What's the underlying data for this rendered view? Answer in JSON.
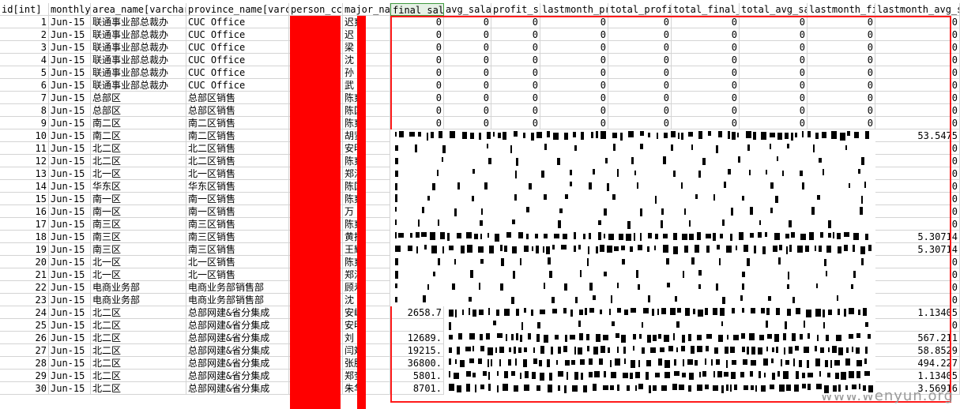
{
  "sheet": {
    "headers": [
      "id[int]",
      "monthly",
      "area_name[varchar",
      "province_name[varc",
      "person_cc",
      "major_na",
      "final_sal",
      "avg_sala",
      "profit_s",
      "lastmonth_pr",
      "total_profi",
      "total_final_",
      "total_avg_sa",
      "lastmonth_fi",
      "lastmonth_avg_s"
    ],
    "selected_header": "final_sal",
    "rows": [
      {
        "id": "1",
        "month": "Jun-15",
        "area": "联通事业部总裁办",
        "province": "CUC Office",
        "major": "迟爽",
        "vals": [
          "0",
          "0",
          "0",
          "0",
          "0",
          "0",
          "0",
          "0",
          "0"
        ]
      },
      {
        "id": "2",
        "month": "Jun-15",
        "area": "联通事业部总裁办",
        "province": "CUC Office",
        "major": "迟",
        "vals": [
          "0",
          "0",
          "0",
          "0",
          "0",
          "0",
          "0",
          "0",
          "0"
        ]
      },
      {
        "id": "3",
        "month": "Jun-15",
        "area": "联通事业部总裁办",
        "province": "CUC Office",
        "major": "梁",
        "vals": [
          "0",
          "0",
          "0",
          "0",
          "0",
          "0",
          "0",
          "0",
          "0"
        ]
      },
      {
        "id": "4",
        "month": "Jun-15",
        "area": "联通事业部总裁办",
        "province": "CUC Office",
        "major": "沈",
        "vals": [
          "0",
          "0",
          "0",
          "0",
          "0",
          "0",
          "0",
          "0",
          "0"
        ]
      },
      {
        "id": "5",
        "month": "Jun-15",
        "area": "联通事业部总裁办",
        "province": "CUC Office",
        "major": "孙",
        "vals": [
          "0",
          "0",
          "0",
          "0",
          "0",
          "0",
          "0",
          "0",
          "0"
        ]
      },
      {
        "id": "6",
        "month": "Jun-15",
        "area": "联通事业部总裁办",
        "province": "CUC Office",
        "major": "武",
        "vals": [
          "0",
          "0",
          "0",
          "0",
          "0",
          "0",
          "0",
          "0",
          "0"
        ]
      },
      {
        "id": "7",
        "month": "Jun-15",
        "area": "总部区",
        "province": "总部区销售",
        "major": "陈爽",
        "vals": [
          "0",
          "0",
          "0",
          "0",
          "0",
          "0",
          "0",
          "0",
          "0"
        ]
      },
      {
        "id": "8",
        "month": "Jun-15",
        "area": "总部区",
        "province": "总部区销售",
        "major": "陈国",
        "vals": [
          "0",
          "0",
          "0",
          "0",
          "0",
          "0",
          "0",
          "0",
          "0"
        ]
      },
      {
        "id": "9",
        "month": "Jun-15",
        "area": "南二区",
        "province": "南二区销售",
        "major": "陈爽",
        "vals": [
          "0",
          "0",
          "0",
          "0",
          "0",
          "0",
          "0",
          "0",
          "0"
        ]
      },
      {
        "id": "10",
        "month": "Jun-15",
        "area": "南二区",
        "province": "南二区销售",
        "major": "胡贤",
        "vals": [
          "",
          "",
          "",
          "",
          "",
          "",
          "",
          "",
          "53.5475"
        ]
      },
      {
        "id": "11",
        "month": "Jun-15",
        "area": "北二区",
        "province": "北二区销售",
        "major": "安明",
        "vals": [
          "",
          "",
          "",
          "",
          "",
          "",
          "",
          "",
          "0"
        ]
      },
      {
        "id": "12",
        "month": "Jun-15",
        "area": "北二区",
        "province": "北二区销售",
        "major": "陈爽",
        "vals": [
          "",
          "",
          "",
          "",
          "",
          "",
          "",
          "",
          "0"
        ]
      },
      {
        "id": "13",
        "month": "Jun-15",
        "area": "北一区",
        "province": "北一区销售",
        "major": "郑江",
        "vals": [
          "",
          "",
          "",
          "",
          "",
          "",
          "",
          "",
          "0"
        ]
      },
      {
        "id": "14",
        "month": "Jun-15",
        "area": "华东区",
        "province": "华东区销售",
        "major": "陈国",
        "vals": [
          "",
          "",
          "",
          "",
          "",
          "",
          "",
          "",
          "0"
        ]
      },
      {
        "id": "15",
        "month": "Jun-15",
        "area": "南一区",
        "province": "南一区销售",
        "major": "陈爽",
        "vals": [
          "",
          "",
          "",
          "",
          "",
          "",
          "",
          "",
          "0"
        ]
      },
      {
        "id": "16",
        "month": "Jun-15",
        "area": "南一区",
        "province": "南一区销售",
        "major": "万",
        "vals": [
          "",
          "",
          "",
          "",
          "",
          "",
          "",
          "",
          "0"
        ]
      },
      {
        "id": "17",
        "month": "Jun-15",
        "area": "南三区",
        "province": "南三区销售",
        "major": "陈爽",
        "vals": [
          "",
          "",
          "",
          "",
          "",
          "",
          "",
          "",
          "0"
        ]
      },
      {
        "id": "18",
        "month": "Jun-15",
        "area": "南三区",
        "province": "南三区销售",
        "major": "黄扬",
        "vals": [
          "",
          "",
          "",
          "",
          "",
          "",
          "",
          "",
          "5.30714"
        ]
      },
      {
        "id": "19",
        "month": "Jun-15",
        "area": "南三区",
        "province": "南三区销售",
        "major": "王辉",
        "vals": [
          "",
          "",
          "",
          "",
          "",
          "",
          "",
          "",
          "5.30714"
        ]
      },
      {
        "id": "20",
        "month": "Jun-15",
        "area": "北一区",
        "province": "北一区销售",
        "major": "陈爽",
        "vals": [
          "",
          "",
          "",
          "",
          "",
          "",
          "",
          "",
          "0"
        ]
      },
      {
        "id": "21",
        "month": "Jun-15",
        "area": "北一区",
        "province": "北一区销售",
        "major": "郑江",
        "vals": [
          "",
          "",
          "",
          "",
          "",
          "",
          "",
          "",
          "0"
        ]
      },
      {
        "id": "22",
        "month": "Jun-15",
        "area": "电商业务部",
        "province": "电商业务部销售部",
        "major": "顾寿",
        "vals": [
          "",
          "",
          "",
          "",
          "",
          "",
          "",
          "",
          "0"
        ]
      },
      {
        "id": "23",
        "month": "Jun-15",
        "area": "电商业务部",
        "province": "电商业务部销售部",
        "major": "沈",
        "vals": [
          "",
          "",
          "",
          "",
          "",
          "",
          "",
          "",
          "0"
        ]
      },
      {
        "id": "24",
        "month": "Jun-15",
        "area": "北二区",
        "province": "总部网建&省分集成",
        "major": "安峰",
        "vals": [
          "2658.7",
          "",
          "",
          "",
          "",
          "",
          "",
          "",
          "1.13405"
        ]
      },
      {
        "id": "25",
        "month": "Jun-15",
        "area": "北二区",
        "province": "总部网建&省分集成",
        "major": "安明",
        "vals": [
          "",
          "",
          "",
          "",
          "",
          "",
          "",
          "",
          "0"
        ]
      },
      {
        "id": "26",
        "month": "Jun-15",
        "area": "北二区",
        "province": "总部网建&省分集成",
        "major": "刘",
        "vals": [
          "12689.",
          "",
          "",
          "",
          "",
          "",
          "",
          "",
          "567.211"
        ]
      },
      {
        "id": "27",
        "month": "Jun-15",
        "area": "北二区",
        "province": "总部网建&省分集成",
        "major": "闫斌",
        "vals": [
          "19215.",
          "",
          "",
          "",
          "",
          "",
          "",
          "",
          "58.8529"
        ]
      },
      {
        "id": "28",
        "month": "Jun-15",
        "area": "北二区",
        "province": "总部网建&省分集成",
        "major": "张胜",
        "vals": [
          "36800.",
          "",
          "",
          "",
          "",
          "",
          "",
          "",
          "494.227"
        ]
      },
      {
        "id": "29",
        "month": "Jun-15",
        "area": "北二区",
        "province": "总部网建&省分集成",
        "major": "郑奎",
        "vals": [
          "5801.",
          "",
          "",
          "",
          "",
          "",
          "",
          "",
          "1.13405"
        ]
      },
      {
        "id": "30",
        "month": "Jun-15",
        "area": "北二区",
        "province": "总部网建&省分集成",
        "major": "朱华",
        "vals": [
          "8701.",
          "",
          "",
          "",
          "",
          "",
          "",
          "",
          "3.56916"
        ]
      }
    ]
  },
  "watermark": "www.wenyun.org",
  "colors": {
    "redaction": "#ff0000",
    "selection": "#3f9a3f",
    "grid": "#d4d4d4"
  }
}
